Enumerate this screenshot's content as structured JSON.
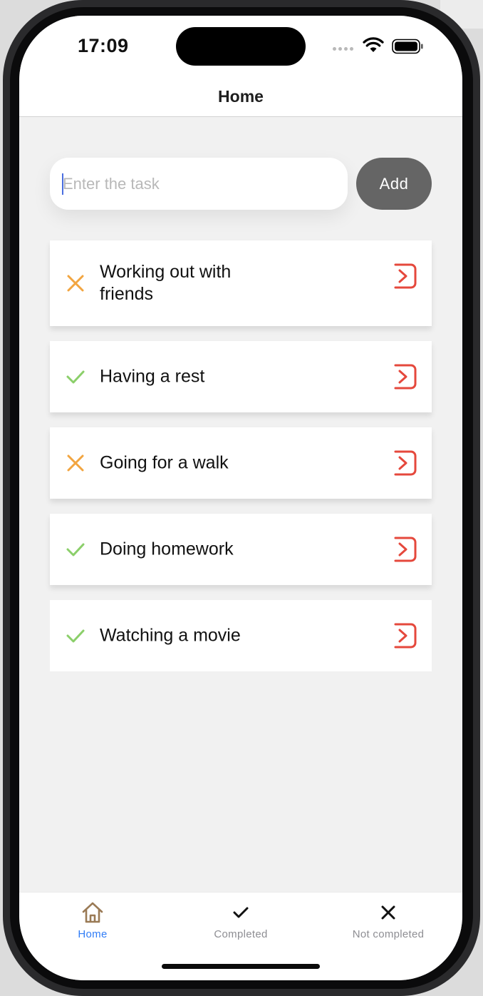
{
  "status_bar": {
    "time": "17:09"
  },
  "nav": {
    "title": "Home"
  },
  "input": {
    "placeholder": "Enter the task",
    "value": "",
    "add_label": "Add"
  },
  "tasks": [
    {
      "text": "Working out with friends",
      "status": "not-completed",
      "status_icon": "cross-icon"
    },
    {
      "text": "Having a rest",
      "status": "completed",
      "status_icon": "check-icon"
    },
    {
      "text": "Going for a walk",
      "status": "not-completed",
      "status_icon": "cross-icon"
    },
    {
      "text": "Doing homework",
      "status": "completed",
      "status_icon": "check-icon"
    },
    {
      "text": "Watching a movie",
      "status": "completed",
      "status_icon": "check-icon"
    }
  ],
  "tabs": [
    {
      "label": "Home",
      "icon": "home-icon",
      "active": true
    },
    {
      "label": "Completed",
      "icon": "check-icon",
      "active": false
    },
    {
      "label": "Not completed",
      "icon": "close-icon",
      "active": false
    }
  ],
  "colors": {
    "completed": "#8bcf6a",
    "not_completed": "#f2a540",
    "edit_icon": "#e5483c",
    "active_tab": "#2f7cf6",
    "add_button": "#656565"
  }
}
